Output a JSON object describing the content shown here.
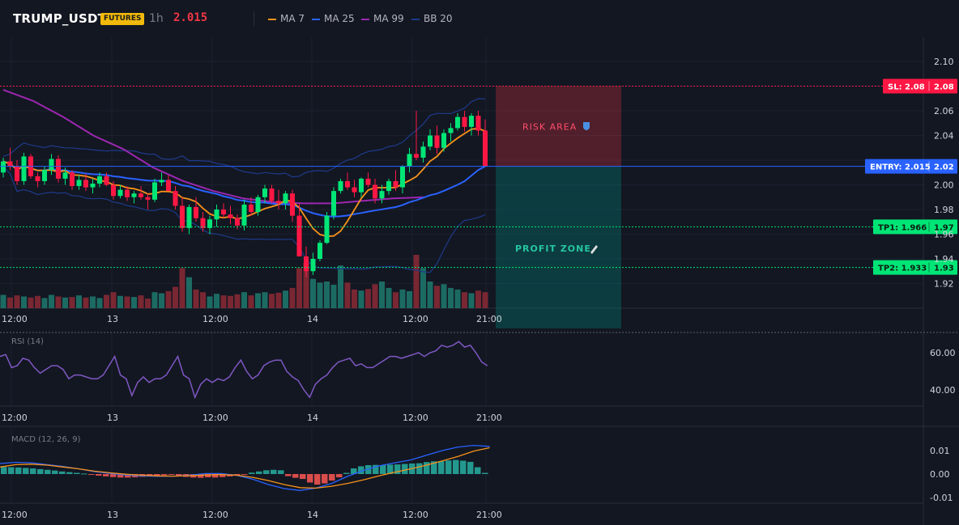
{
  "header": {
    "symbol": "TRUMP_USDT",
    "badge": "FUTURES",
    "timeframe": "1h",
    "last_price": "2.015",
    "legend": [
      {
        "label": "MA 7",
        "color": "#f7931a"
      },
      {
        "label": "MA 25",
        "color": "#2962ff"
      },
      {
        "label": "MA 99",
        "color": "#9c27b0"
      },
      {
        "label": "BB 20",
        "color": "#1e3a8a"
      }
    ]
  },
  "colors": {
    "up": "#26a69a",
    "up_bright": "#00e676",
    "down": "#f23645",
    "down_bright": "#ff1744",
    "ma7": "#f7931a",
    "ma25": "#2962ff",
    "ma99": "#9c27b0",
    "bb": "#1e3a8a"
  },
  "chart_data": [
    {
      "type": "candlestick",
      "title": "TRUMP_USDT",
      "x_tick_labels": [
        "12:00",
        "13",
        "12:00",
        "14",
        "12:00",
        "21:00"
      ],
      "y_tick_labels": [
        "2.10",
        "2.08",
        "2.06",
        "2.04",
        "2.02",
        "2.00",
        "1.98",
        "1.96",
        "1.94",
        "1.92"
      ],
      "ylim": [
        1.905,
        2.113
      ],
      "ohlc": [
        [
          2.01,
          2.022,
          2.006,
          2.019
        ],
        [
          2.019,
          2.03,
          2.012,
          2.015
        ],
        [
          2.015,
          2.02,
          2.0,
          2.003
        ],
        [
          2.003,
          2.026,
          2.0,
          2.023
        ],
        [
          2.023,
          2.025,
          2.005,
          2.007
        ],
        [
          2.007,
          2.01,
          1.998,
          2.003
        ],
        [
          2.003,
          2.015,
          2.0,
          2.012
        ],
        [
          2.012,
          2.025,
          2.008,
          2.021
        ],
        [
          2.021,
          2.024,
          2.002,
          2.005
        ],
        [
          2.005,
          2.014,
          2.0,
          2.01
        ],
        [
          2.01,
          2.012,
          1.996,
          1.999
        ],
        [
          1.999,
          2.008,
          1.996,
          2.004
        ],
        [
          2.004,
          2.009,
          1.995,
          1.998
        ],
        [
          1.998,
          2.005,
          1.993,
          2.001
        ],
        [
          2.001,
          2.01,
          1.998,
          2.007
        ],
        [
          2.007,
          2.01,
          1.999,
          2.0
        ],
        [
          2.0,
          2.003,
          1.988,
          1.991
        ],
        [
          1.991,
          2.0,
          1.989,
          1.996
        ],
        [
          1.996,
          1.999,
          1.987,
          1.99
        ],
        [
          1.99,
          1.995,
          1.985,
          1.993
        ],
        [
          1.993,
          1.999,
          1.988,
          1.99
        ],
        [
          1.99,
          1.993,
          1.98,
          1.988
        ],
        [
          1.988,
          2.005,
          1.986,
          2.002
        ],
        [
          2.002,
          2.01,
          1.999,
          2.004
        ],
        [
          2.004,
          2.008,
          1.995,
          1.995
        ],
        [
          1.995,
          1.999,
          1.98,
          1.983
        ],
        [
          1.983,
          1.99,
          1.962,
          1.965
        ],
        [
          1.965,
          1.984,
          1.96,
          1.982
        ],
        [
          1.982,
          1.99,
          1.97,
          1.973
        ],
        [
          1.973,
          1.978,
          1.962,
          1.965
        ],
        [
          1.965,
          1.975,
          1.96,
          1.972
        ],
        [
          1.972,
          1.984,
          1.966,
          1.98
        ],
        [
          1.98,
          1.985,
          1.973,
          1.976
        ],
        [
          1.976,
          1.983,
          1.968,
          1.973
        ],
        [
          1.973,
          1.976,
          1.964,
          1.967
        ],
        [
          1.967,
          1.988,
          1.963,
          1.984
        ],
        [
          1.984,
          1.99,
          1.975,
          1.978
        ],
        [
          1.978,
          1.992,
          1.975,
          1.99
        ],
        [
          1.99,
          2.0,
          1.985,
          1.997
        ],
        [
          1.997,
          2.0,
          1.985,
          1.987
        ],
        [
          1.987,
          1.996,
          1.98,
          1.985
        ],
        [
          1.985,
          1.995,
          1.98,
          1.993
        ],
        [
          1.993,
          1.996,
          1.97,
          1.975
        ],
        [
          1.975,
          1.985,
          1.96,
          1.942
        ],
        [
          1.942,
          1.95,
          1.925,
          1.93
        ],
        [
          1.93,
          1.945,
          1.927,
          1.94
        ],
        [
          1.94,
          1.955,
          1.938,
          1.953
        ],
        [
          1.953,
          1.978,
          1.952,
          1.975
        ],
        [
          1.975,
          1.998,
          1.972,
          1.995
        ],
        [
          1.995,
          2.005,
          1.993,
          2.003
        ],
        [
          2.003,
          2.01,
          1.996,
          1.998
        ],
        [
          1.998,
          2.004,
          1.99,
          1.994
        ],
        [
          1.994,
          2.006,
          1.99,
          2.005
        ],
        [
          2.005,
          2.01,
          1.998,
          2.0
        ],
        [
          2.0,
          2.005,
          1.985,
          1.989
        ],
        [
          1.989,
          2.0,
          1.985,
          1.995
        ],
        [
          1.995,
          2.005,
          1.992,
          2.003
        ],
        [
          2.003,
          2.012,
          1.995,
          1.998
        ],
        [
          1.998,
          2.016,
          1.993,
          2.015
        ],
        [
          2.015,
          2.03,
          2.01,
          2.025
        ],
        [
          2.025,
          2.06,
          2.02,
          2.022
        ],
        [
          2.022,
          2.035,
          2.018,
          2.031
        ],
        [
          2.031,
          2.045,
          2.028,
          2.04
        ],
        [
          2.04,
          2.048,
          2.025,
          2.03
        ],
        [
          2.03,
          2.045,
          2.027,
          2.042
        ],
        [
          2.042,
          2.05,
          2.035,
          2.046
        ],
        [
          2.046,
          2.058,
          2.044,
          2.055
        ],
        [
          2.055,
          2.06,
          2.043,
          2.047
        ],
        [
          2.047,
          2.058,
          2.04,
          2.056
        ],
        [
          2.056,
          2.06,
          2.04,
          2.044
        ],
        [
          2.044,
          2.053,
          2.025,
          2.015
        ]
      ],
      "volume": [
        0.25,
        0.2,
        0.24,
        0.22,
        0.2,
        0.23,
        0.19,
        0.25,
        0.22,
        0.2,
        0.21,
        0.24,
        0.2,
        0.22,
        0.19,
        0.25,
        0.3,
        0.23,
        0.22,
        0.21,
        0.24,
        0.18,
        0.3,
        0.28,
        0.32,
        0.4,
        0.75,
        0.58,
        0.35,
        0.3,
        0.22,
        0.27,
        0.24,
        0.23,
        0.26,
        0.3,
        0.24,
        0.28,
        0.3,
        0.27,
        0.29,
        0.33,
        0.38,
        0.75,
        0.85,
        0.55,
        0.48,
        0.5,
        0.44,
        0.8,
        0.48,
        0.35,
        0.33,
        0.36,
        0.45,
        0.5,
        0.38,
        0.3,
        0.35,
        0.32,
        1.0,
        0.75,
        0.5,
        0.42,
        0.45,
        0.38,
        0.35,
        0.3,
        0.28,
        0.33,
        0.3
      ],
      "series": [
        {
          "name": "MA 7",
          "color": "#f7931a"
        },
        {
          "name": "MA 25",
          "color": "#2962ff"
        },
        {
          "name": "MA 99",
          "color": "#9c27b0"
        },
        {
          "name": "BB 20",
          "color": "#1e3a8a"
        }
      ],
      "ma99": [
        [
          0,
          2.077
        ],
        [
          10,
          2.068
        ],
        [
          20,
          2.055
        ],
        [
          30,
          2.04
        ],
        [
          40,
          2.029
        ],
        [
          50,
          2.014
        ],
        [
          60,
          2.003
        ],
        [
          70,
          1.995
        ],
        [
          80,
          1.989
        ],
        [
          90,
          1.986
        ],
        [
          100,
          1.985
        ],
        [
          110,
          1.985
        ],
        [
          120,
          1.987
        ],
        [
          130,
          1.989
        ],
        [
          140,
          1.99
        ]
      ],
      "levels": [
        {
          "kind": "sl",
          "value": 2.08,
          "label": "SL: 2.08",
          "axis_label": "2.08",
          "color": "#ff1744"
        },
        {
          "kind": "entry",
          "value": 2.015,
          "label": "ENTRY: 2.015",
          "axis_label": "2.02",
          "color": "#2962ff"
        },
        {
          "kind": "tp1",
          "value": 1.966,
          "label": "TP1: 1.966",
          "axis_label": "1.97",
          "color": "#00e676"
        },
        {
          "kind": "tp2",
          "value": 1.933,
          "label": "TP2: 1.933",
          "axis_label": "1.93",
          "color": "#00e676"
        }
      ],
      "zones": {
        "risk": {
          "label": "RISK AREA",
          "from": 2.08,
          "to": 2.015,
          "icon": "shield-icon"
        },
        "profit": {
          "label": "PROFIT ZONE",
          "from": 2.015,
          "to": 1.9,
          "icon": "rocket-icon"
        }
      }
    },
    {
      "type": "line",
      "title": "RSI (14)",
      "y_tick_labels": [
        "60.00",
        "40.00"
      ],
      "ylim": [
        31,
        69
      ],
      "x_tick_labels": [
        "12:00",
        "13",
        "12:00",
        "14",
        "12:00",
        "21:00"
      ],
      "values": [
        58,
        59,
        52,
        53,
        57,
        56,
        52,
        49,
        51,
        53,
        53,
        51,
        46,
        48,
        48,
        47,
        46,
        46,
        48,
        53,
        58,
        48,
        46,
        37,
        44,
        47,
        44,
        46,
        46,
        48,
        53,
        58,
        48,
        46,
        36,
        43,
        46,
        44,
        46,
        45,
        47,
        52,
        56,
        50,
        46,
        48,
        53,
        55,
        56,
        56,
        50,
        47,
        45,
        40,
        36,
        43,
        46,
        48,
        52,
        55,
        56,
        57,
        53,
        54,
        52,
        52,
        54,
        56,
        58,
        58,
        57,
        58,
        59,
        60,
        58,
        60,
        61,
        64,
        63,
        64,
        66,
        63,
        64,
        60,
        55,
        53
      ]
    },
    {
      "type": "bar",
      "title": "MACD (12, 26, 9)",
      "y_tick_labels": [
        "0.01",
        "0.00",
        "-0.01"
      ],
      "ylim": [
        -0.0135,
        0.0145
      ],
      "x_tick_labels": [
        "12:00",
        "13",
        "12:00",
        "14",
        "12:00",
        "21:00"
      ],
      "histogram": [
        0.003,
        0.0029,
        0.0028,
        0.0026,
        0.0024,
        0.0021,
        0.0018,
        0.0015,
        0.0011,
        0.0008,
        0.0005,
        0.0002,
        -0.0003,
        -0.0007,
        -0.001,
        -0.0013,
        -0.0015,
        -0.0015,
        -0.0014,
        -0.0012,
        -0.001,
        -0.0008,
        -0.0005,
        -0.0003,
        -0.0007,
        -0.0012,
        -0.0015,
        -0.0016,
        -0.0014,
        -0.0015,
        -0.0013,
        -0.001,
        -0.0006,
        -0.0002,
        0.0006,
        0.0011,
        0.0016,
        0.0018,
        0.0016,
        -0.0009,
        -0.0016,
        -0.0021,
        -0.0036,
        -0.0045,
        -0.004,
        -0.0028,
        -0.0014,
        0.0005,
        0.0024,
        0.0033,
        0.0038,
        0.0039,
        0.0038,
        0.004,
        0.0041,
        0.0043,
        0.0045,
        0.0046,
        0.0051,
        0.0054,
        0.0055,
        0.0058,
        0.006,
        0.0057,
        0.0052,
        0.0029,
        0.0005
      ],
      "series": [
        {
          "name": "MACD",
          "color": "#2962ff",
          "values": [
            0.0045,
            0.005,
            0.0048,
            0.004,
            0.0032,
            0.0022,
            0.001,
            0.0002,
            -0.0004,
            -0.0008,
            -0.001,
            -0.0009,
            -0.0005,
            0.0002,
            0.0002,
            -0.0006,
            -0.0022,
            -0.0045,
            -0.0062,
            -0.007,
            -0.006,
            -0.004,
            -0.001,
            0.0015,
            0.0035,
            0.0048,
            0.006,
            0.008,
            0.01,
            0.0115,
            0.0122,
            0.0118
          ]
        },
        {
          "name": "Signal",
          "color": "#f7931a",
          "values": [
            0.003,
            0.004,
            0.0042,
            0.0038,
            0.003,
            0.0022,
            0.0012,
            0.0005,
            -0.0001,
            -0.0005,
            -0.0008,
            -0.0009,
            -0.0007,
            -0.0004,
            -0.0002,
            -0.0005,
            -0.0014,
            -0.0028,
            -0.0045,
            -0.0058,
            -0.006,
            -0.0052,
            -0.004,
            -0.0025,
            -0.0008,
            0.0008,
            0.0022,
            0.0038,
            0.0056,
            0.0075,
            0.0098,
            0.0112
          ]
        }
      ]
    }
  ]
}
